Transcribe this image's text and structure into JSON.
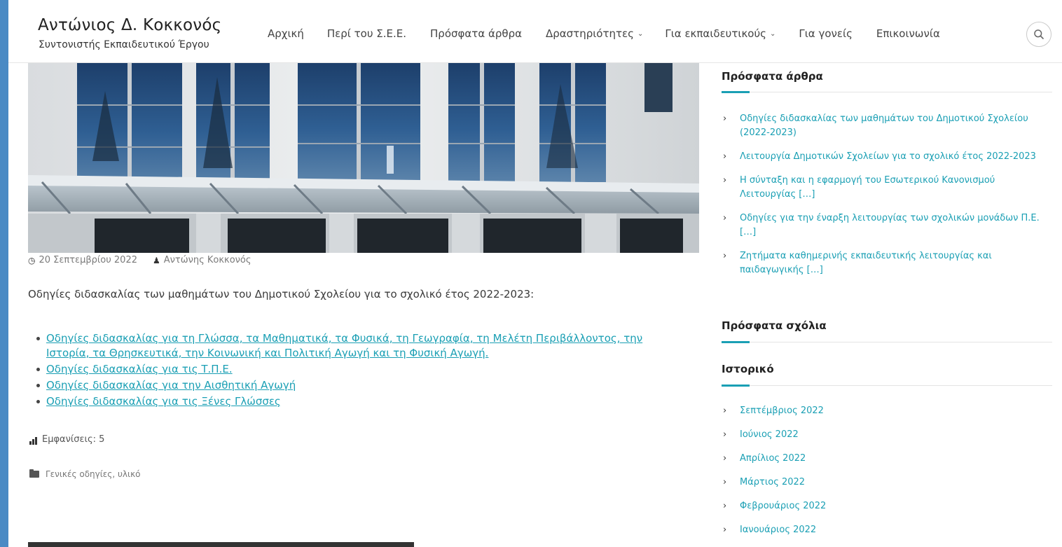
{
  "header": {
    "site_title": "Αντώνιος Δ. Κοκκονός",
    "site_subtitle": "Συντονιστής Εκπαιδευτικού Έργου",
    "nav": [
      {
        "label": "Αρχική"
      },
      {
        "label": "Περί του Σ.Ε.Ε."
      },
      {
        "label": "Πρόσφατα άρθρα"
      },
      {
        "label": "Δραστηριότητες",
        "has_dropdown": true
      },
      {
        "label": "Για εκπαιδευτικούς",
        "has_dropdown": true
      },
      {
        "label": "Για γονείς"
      },
      {
        "label": "Επικοινωνία"
      }
    ],
    "search_icon": "search-icon"
  },
  "post": {
    "date": "20 Σεπτεμβρίου 2022",
    "author": "Αντώνης Κοκκονός",
    "intro": "Οδηγίες διδασκαλίας των μαθημάτων του Δημοτικού Σχολείου για το σχολικό έτος 2022-2023:",
    "links": [
      {
        "line1": "Οδηγίες διδασκαλίας για τη Γλώσσα, τα Μαθηματικά, τα Φυσικά, τη Γεωγραφία, τη Μελέτη Περιβάλλοντος, την",
        "line2": "Ιστορία, τα Θρησκευτικά, την Κοινωνική και Πολιτική Αγωγή και τη Φυσική Αγωγή."
      },
      {
        "line1": "Οδηγίες διδασκαλίας για τις Τ.Π.Ε."
      },
      {
        "line1": "Οδηγίες διδασκαλίας για την Αισθητική Αγωγή"
      },
      {
        "line1": "Οδηγίες διδασκαλίας για τις Ξένες Γλώσσες"
      }
    ],
    "views": "Εμφανίσεις: 5",
    "categories": "Γενικές οδηγίες, υλικό"
  },
  "sidebar": {
    "recent_posts_title": "Πρόσφατα άρθρα",
    "recent_posts": [
      [
        "Οδηγίες διδασκαλίας των μαθημάτων του Δημοτικού Σχολείου",
        "(2022-2023)"
      ],
      [
        "Λειτουργία Δημοτικών Σχολείων για το σχολικό έτος 2022-2023"
      ],
      [
        "Η σύνταξη και η εφαρμογή του Εσωτερικού Κανονισμού",
        "Λειτουργίας […]"
      ],
      [
        "Οδηγίες για την έναρξη λειτουργίας των σχολικών μονάδων Π.Ε.",
        "[…]"
      ],
      [
        "Ζητήματα καθημερινής εκπαιδευτικής λειτουργίας και",
        "παιδαγωγικής […]"
      ]
    ],
    "recent_comments_title": "Πρόσφατα σχόλια",
    "archive_title": "Ιστορικό",
    "archive": [
      "Σεπτέμβριος 2022",
      "Ιούνιος 2022",
      "Απρίλιος 2022",
      "Μάρτιος 2022",
      "Φεβρουάριος 2022",
      "Ιανουάριος 2022"
    ]
  },
  "colors": {
    "accent": "#1a9fb4",
    "frame": "#4a8ac4"
  }
}
